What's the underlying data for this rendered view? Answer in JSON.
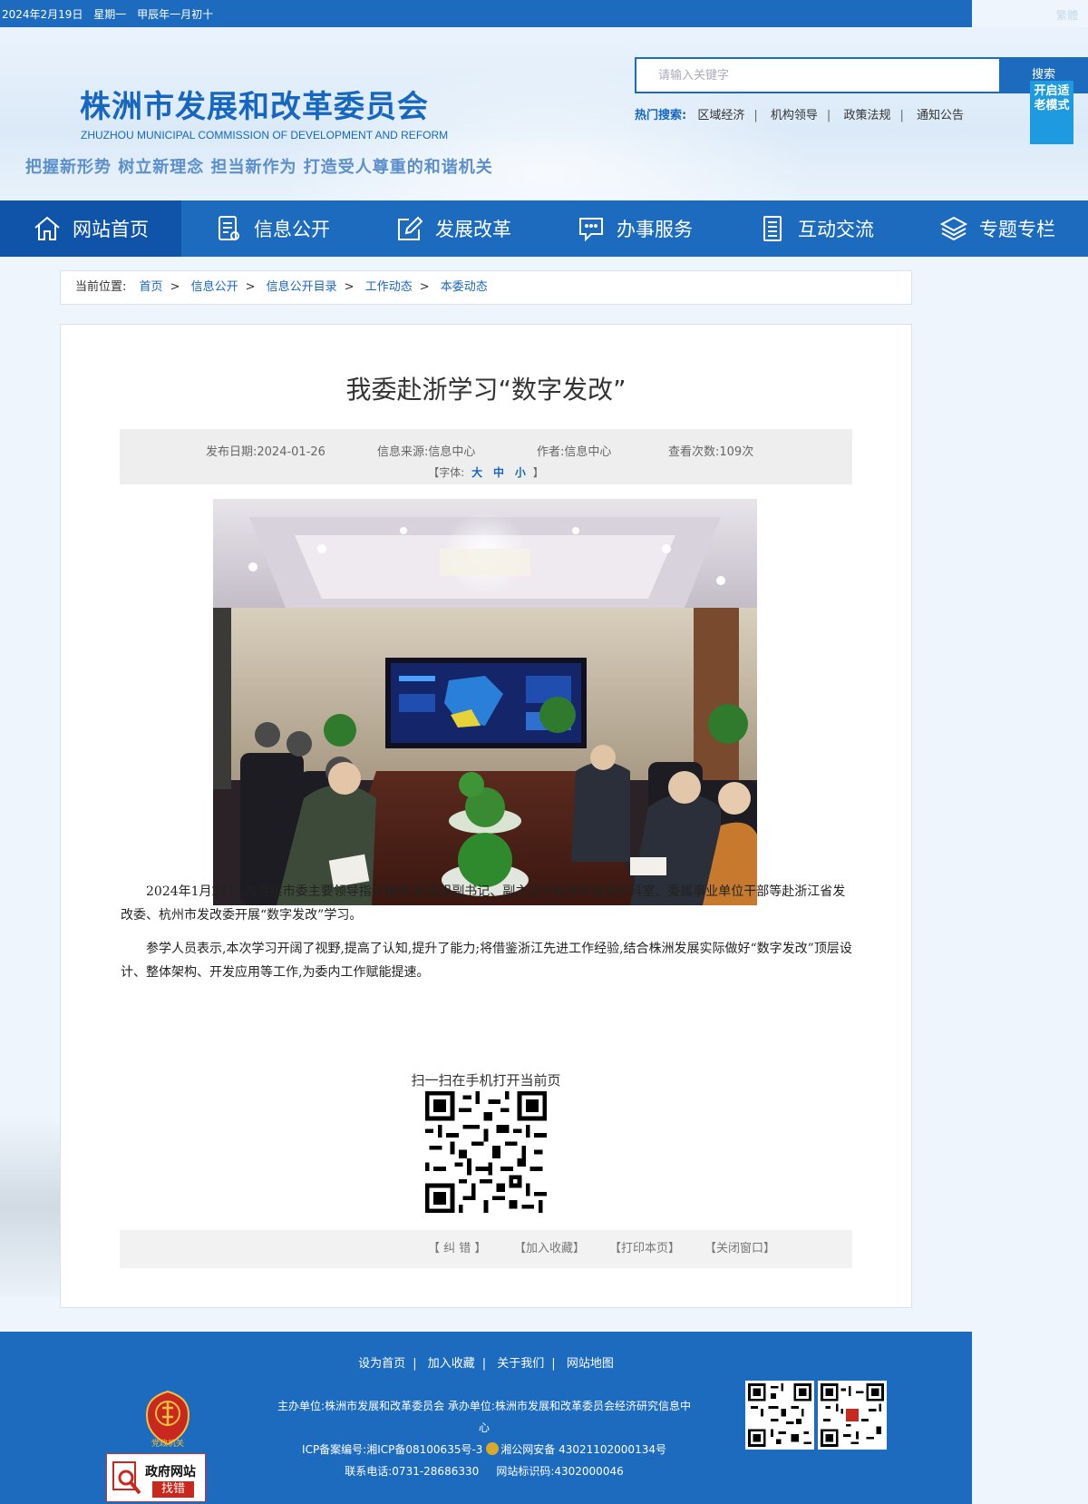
{
  "topbar": {
    "date": "2024年2月19日",
    "weekday": "星期一",
    "lunar": "甲辰年一月初十",
    "right_link": "繁體"
  },
  "header": {
    "title": "株洲市发展和改革委员会",
    "subtitle": "ZHUZHOU MUNICIPAL COMMISSION OF DEVELOPMENT AND REFORM",
    "slogan": "把握新形势 树立新理念 担当新作为 打造受人尊重的和谐机关",
    "search_placeholder": "请输入关键字",
    "search_button": "搜索",
    "elder_mode": "开启适老模式",
    "hot_label": "热门搜索:",
    "hot_items": [
      "区域经济",
      "机构领导",
      "政策法规",
      "通知公告"
    ]
  },
  "nav": {
    "items": [
      {
        "label": "网站首页",
        "icon": "home-icon"
      },
      {
        "label": "信息公开",
        "icon": "document-icon"
      },
      {
        "label": "发展改革",
        "icon": "edit-icon"
      },
      {
        "label": "办事服务",
        "icon": "chat-icon"
      },
      {
        "label": "互动交流",
        "icon": "list-icon"
      },
      {
        "label": "专题专栏",
        "icon": "layers-icon"
      }
    ],
    "active_index": 0
  },
  "breadcrumb": {
    "label": "当前位置:",
    "items": [
      "首页",
      "信息公开",
      "信息公开目录",
      "工作动态",
      "本委动态"
    ]
  },
  "article": {
    "title": "我委赴浙学习“数字发改”",
    "publish_date": "发布日期:2024-01-26",
    "source": "信息来源:信息中心",
    "author": "作者:信息中心",
    "views": "查看次数:109次",
    "font_prefix": "【字体:",
    "font_large": "大",
    "font_medium": "中",
    "font_small": "小",
    "font_suffix": "】",
    "paragraph1": "2024年1月24日,为落实市委主要领导指示精神,委党组副书记、副主任刘和球率委相关科室、委属事业单位干部等赴浙江省发改委、杭州市发改委开展“数字发改”学习。",
    "paragraph2": "参学人员表示,本次学习开阔了视野,提高了认知,提升了能力;将借鉴浙江先进工作经验,结合株洲发展实际做好“数字发改”顶层设计、整体架构、开发应用等工作,为委内工作赋能提速。",
    "qr_label": "扫一扫在手机打开当前页",
    "tools": [
      "【 纠 错 】",
      "【加入收藏】",
      "【打印本页】",
      "【关闭窗口】"
    ]
  },
  "footer": {
    "links": [
      "设为首页",
      "加入收藏",
      "关于我们",
      "网站地图"
    ],
    "organizer": "主办单位:株洲市发展和改革委员会 承办单位:株洲市发展和改革委员会经济研究信息中心",
    "icp": "ICP备案编号:湘ICP备08100635号-3",
    "police": "湘公网安备 43021102000134号",
    "phone": "联系电话:0731-28686330",
    "site_code": "网站标识码:4302000046",
    "party_badge": "党政机关",
    "jiucuo_line1": "政府网站",
    "jiucuo_line2": "找错"
  },
  "colors": {
    "primary": "#1c6bbf",
    "active_nav": "#0f54a8",
    "elder_button": "#1d9ae0",
    "party_red": "#c8281e"
  }
}
